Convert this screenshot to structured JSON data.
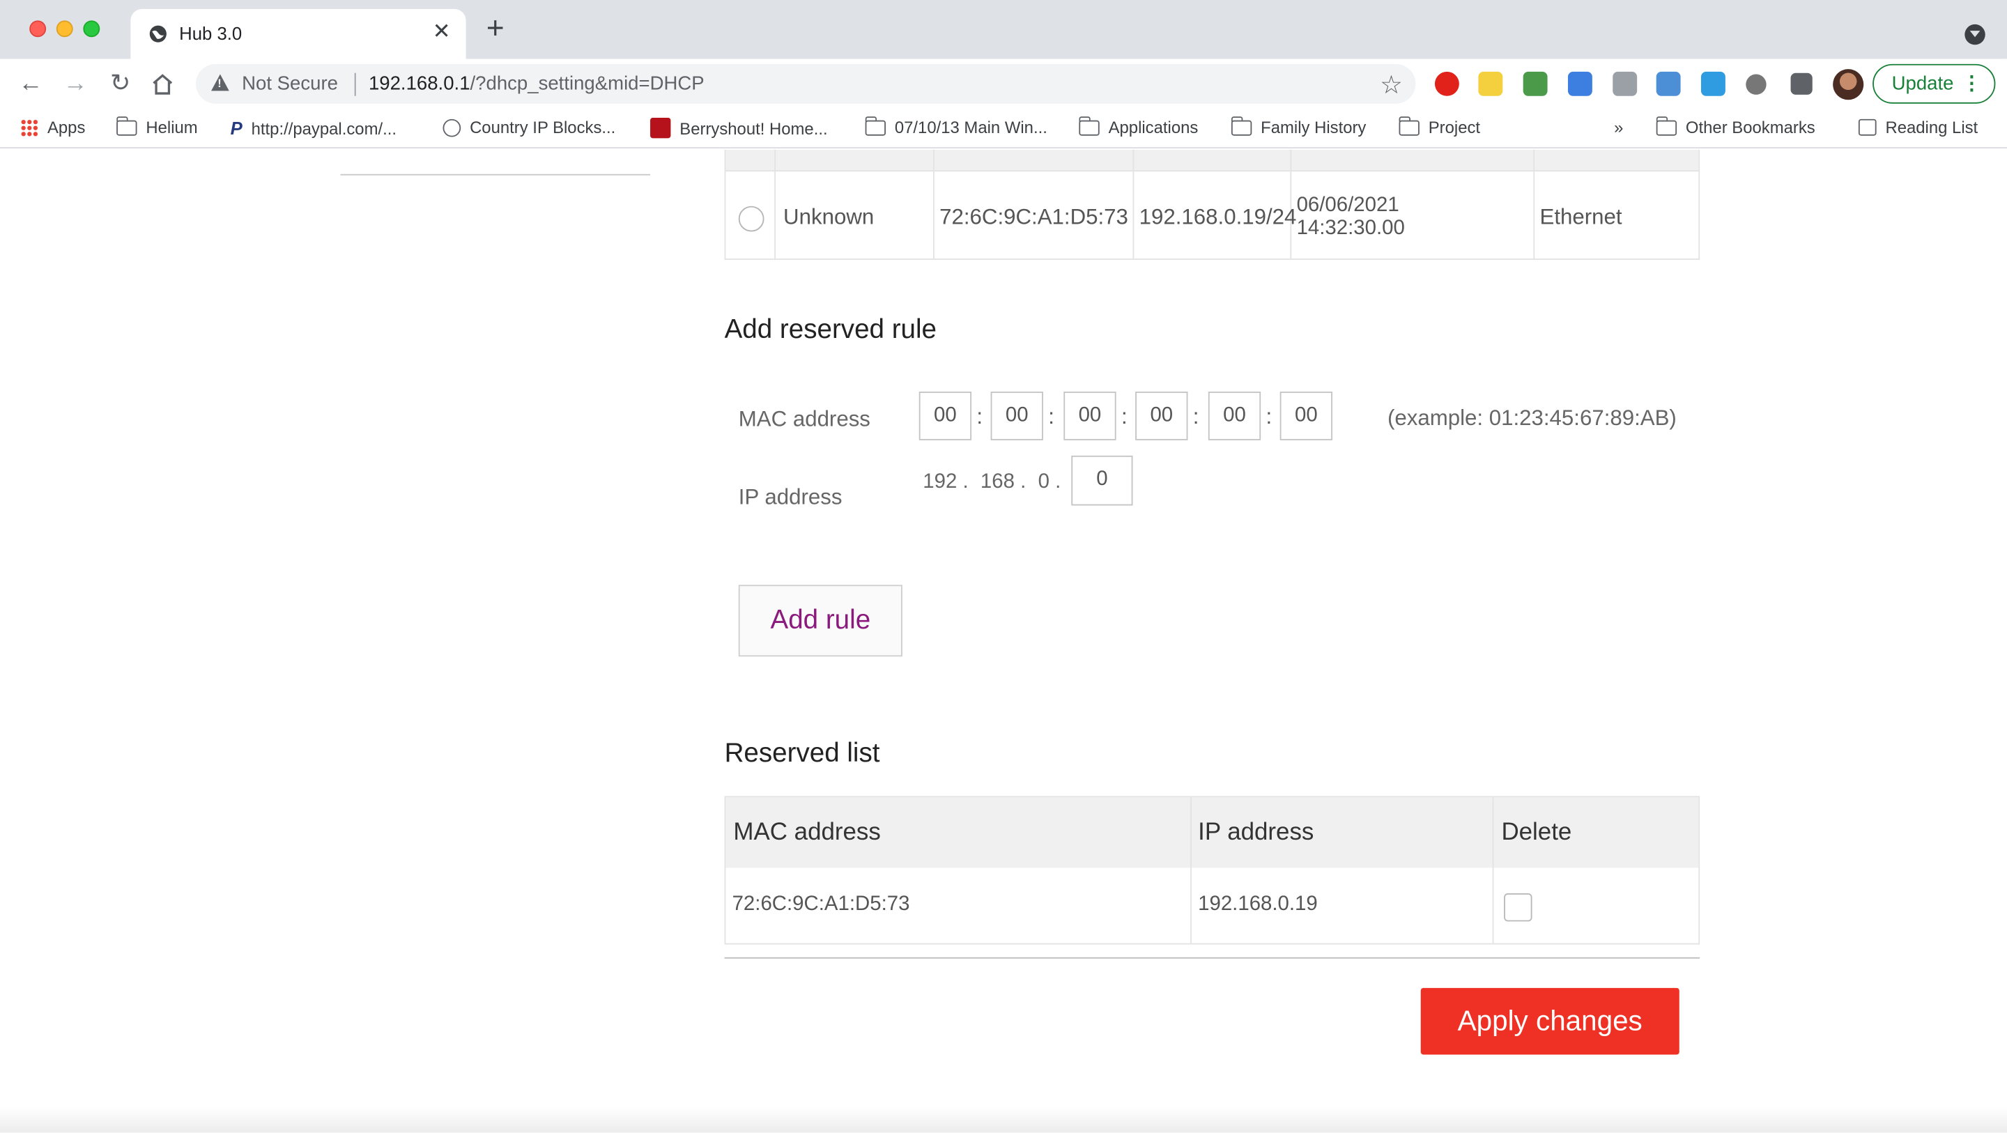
{
  "browser": {
    "tab_title": "Hub 3.0",
    "new_tab_symbol": "+",
    "not_secure_label": "Not Secure",
    "url_host": "192.168.0.1",
    "url_path": "/?dhcp_setting&mid=DHCP",
    "update_label": "Update",
    "extension_icons": [
      "adblock-icon",
      "highlighter-icon",
      "refresh-ext-icon",
      "translate-icon",
      "code-icon",
      "screenshot-icon",
      "bird-icon",
      "circle-ext-icon",
      "puzzle-icon"
    ]
  },
  "bookmarks": {
    "items": [
      {
        "label": "Apps",
        "icon": "apps-grid-icon"
      },
      {
        "label": "Helium",
        "icon": "folder-icon"
      },
      {
        "label": "http://paypal.com/...",
        "icon": "paypal-icon"
      },
      {
        "label": "Country IP Blocks...",
        "icon": "globe-icon"
      },
      {
        "label": "Berryshout! Home...",
        "icon": "berryshout-icon"
      },
      {
        "label": "07/10/13 Main Win...",
        "icon": "folder-icon"
      },
      {
        "label": "Applications",
        "icon": "folder-icon"
      },
      {
        "label": "Family History",
        "icon": "folder-icon"
      },
      {
        "label": "Project",
        "icon": "folder-icon"
      }
    ],
    "overflow": "»",
    "other_bookmarks": "Other Bookmarks",
    "reading_list": "Reading List"
  },
  "client_table": {
    "row": {
      "name": "Unknown",
      "mac": "72:6C:9C:A1:D5:73",
      "ip": "192.168.0.19/24",
      "date": "06/06/2021",
      "time": "14:32:30.00",
      "connection": "Ethernet"
    }
  },
  "add_rule": {
    "title": "Add reserved rule",
    "mac_label": "MAC address",
    "mac_octets": [
      "00",
      "00",
      "00",
      "00",
      "00",
      "00"
    ],
    "separator": ":",
    "example": "(example: 01:23:45:67:89:AB)",
    "ip_label": "IP address",
    "ip_fixed": [
      "192 .",
      "168 .",
      "0 ."
    ],
    "ip_last": "0",
    "button": "Add rule"
  },
  "reserved_list": {
    "title": "Reserved list",
    "headers": [
      "MAC address",
      "IP address",
      "Delete"
    ],
    "rows": [
      {
        "mac": "72:6C:9C:A1:D5:73",
        "ip": "192.168.0.19",
        "delete": false
      }
    ]
  },
  "apply_label": "Apply changes",
  "colors": {
    "accent_purple": "#8a1a7e",
    "apply_red": "#ee3124",
    "update_green": "#188038"
  }
}
